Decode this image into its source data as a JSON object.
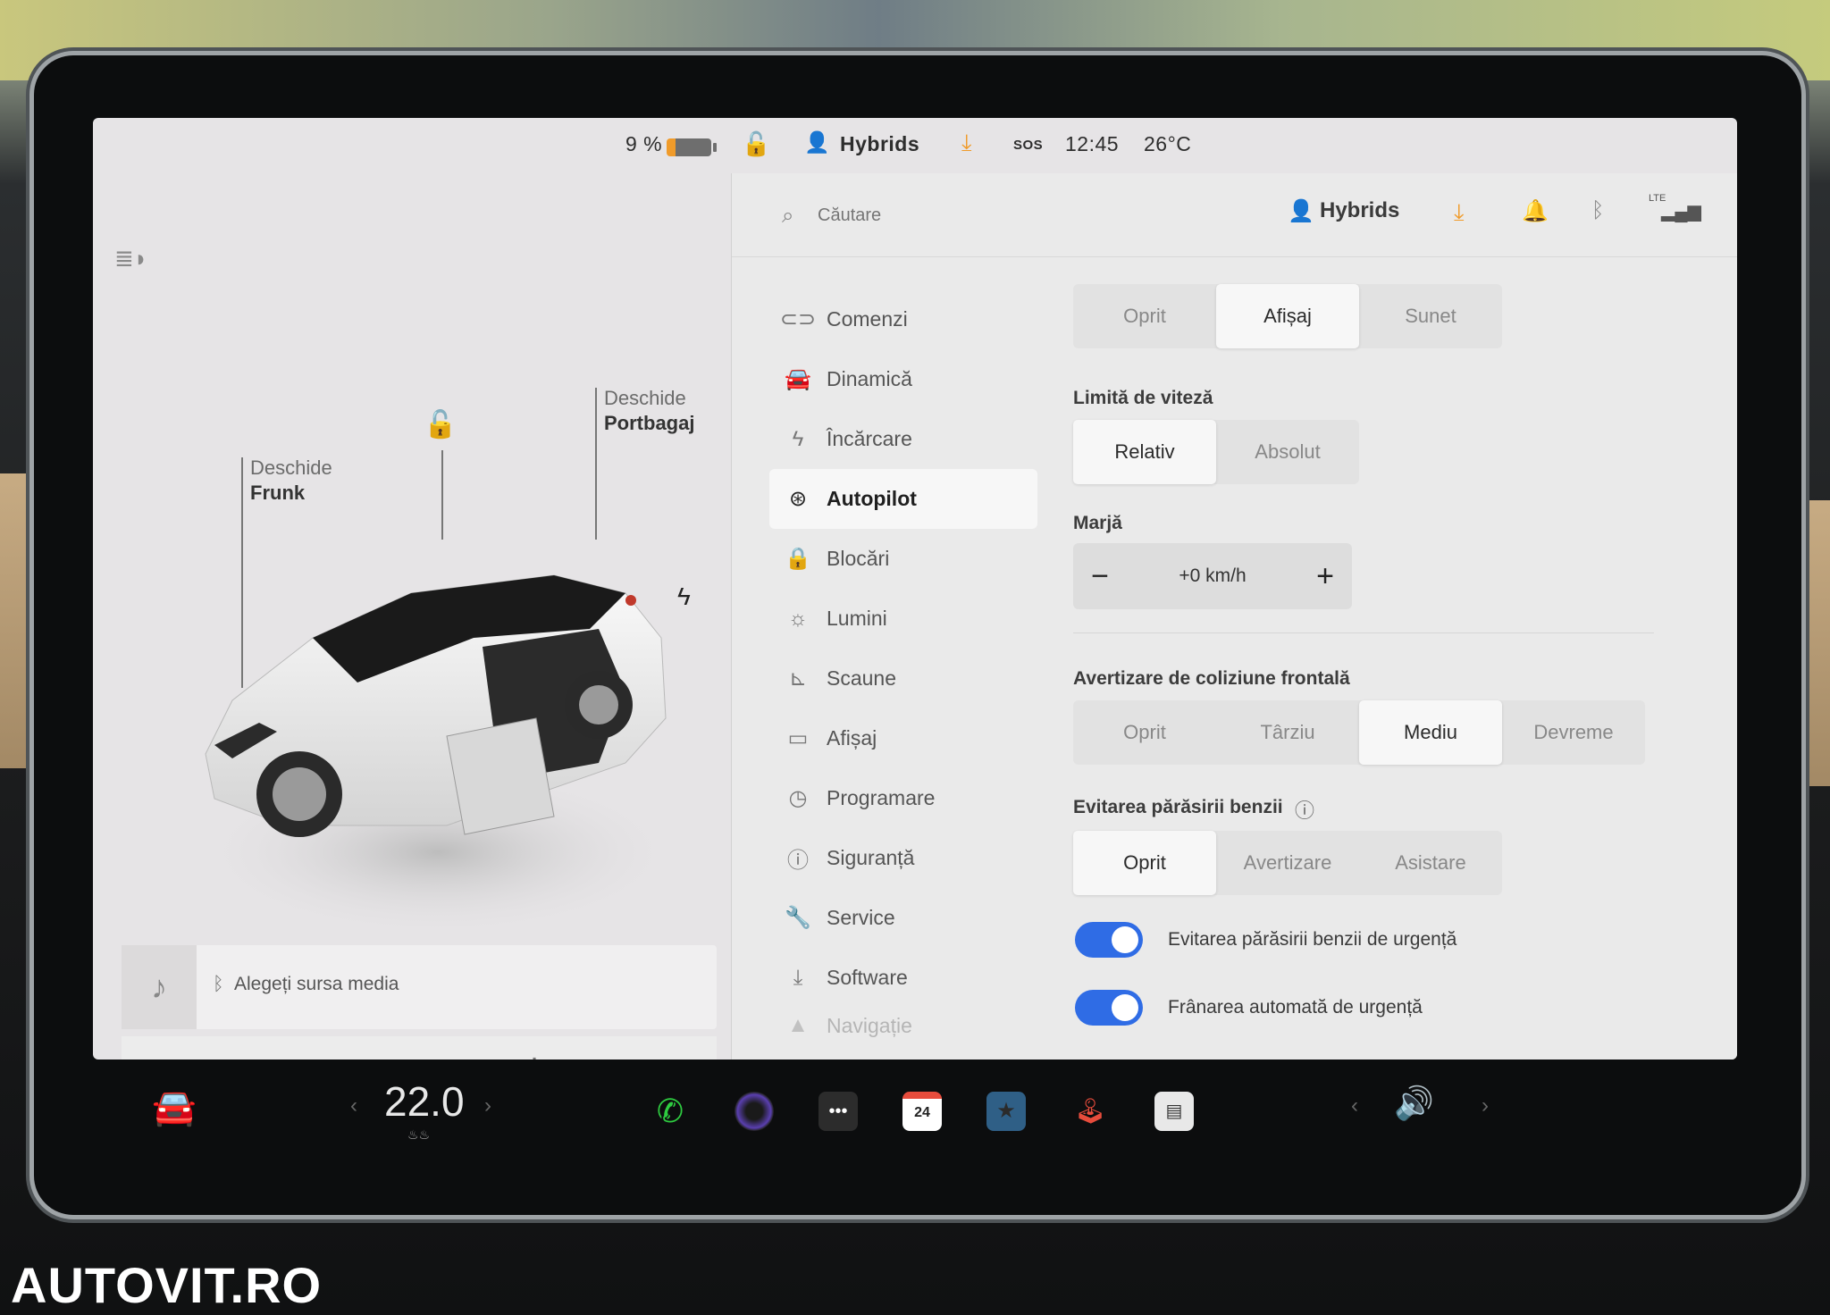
{
  "status_bar": {
    "battery": "9 %",
    "battery_level": 0.09,
    "profile": "Hybrids",
    "sos": "SOS",
    "time": "12:45",
    "temperature": "26°C"
  },
  "car_panel": {
    "frunk_line1": "Deschide",
    "frunk_line2": "Frunk",
    "trunk_line1": "Deschide",
    "trunk_line2": "Portbagaj"
  },
  "media": {
    "source_prompt": "Alegeți sursa media"
  },
  "settings_header": {
    "search_placeholder": "Căutare",
    "profile": "Hybrids",
    "lte": "LTE"
  },
  "menu": [
    {
      "label": "Comenzi",
      "icon": "toggle-icon"
    },
    {
      "label": "Dinamică",
      "icon": "car-icon"
    },
    {
      "label": "Încărcare",
      "icon": "bolt-icon"
    },
    {
      "label": "Autopilot",
      "icon": "steering-wheel-icon",
      "active": true
    },
    {
      "label": "Blocări",
      "icon": "lock-icon"
    },
    {
      "label": "Lumini",
      "icon": "sun-icon"
    },
    {
      "label": "Scaune",
      "icon": "seat-icon"
    },
    {
      "label": "Afișaj",
      "icon": "display-icon"
    },
    {
      "label": "Programare",
      "icon": "clock-icon"
    },
    {
      "label": "Siguranță",
      "icon": "alert-icon"
    },
    {
      "label": "Service",
      "icon": "wrench-icon"
    },
    {
      "label": "Software",
      "icon": "download-icon"
    },
    {
      "label": "Navigație",
      "icon": "navigation-icon"
    }
  ],
  "speed_warning": {
    "options": [
      "Oprit",
      "Afișaj",
      "Sunet"
    ],
    "selected": "Afișaj"
  },
  "speed_limit": {
    "label": "Limită de viteză",
    "options": [
      "Relativ",
      "Absolut"
    ],
    "selected": "Relativ"
  },
  "margin": {
    "label": "Marjă",
    "minus": "−",
    "value": "+0 km/h",
    "plus": "+"
  },
  "forward_collision": {
    "label": "Avertizare de coliziune frontală",
    "options": [
      "Oprit",
      "Târziu",
      "Mediu",
      "Devreme"
    ],
    "selected": "Mediu"
  },
  "lane_departure": {
    "label": "Evitarea părăsirii benzii",
    "options": [
      "Oprit",
      "Avertizare",
      "Asistare"
    ],
    "selected": "Oprit"
  },
  "toggles": [
    {
      "label": "Evitarea părăsirii benzii de urgență",
      "on": true
    },
    {
      "label": "Frânarea automată de urgență",
      "on": true
    }
  ],
  "taskbar": {
    "cabin_temp": "22.0",
    "calendar_day": "24"
  },
  "watermark": "AUTOVIT.RO",
  "colors": {
    "accent": "#2f6ce5",
    "warning": "#f09b2a"
  }
}
